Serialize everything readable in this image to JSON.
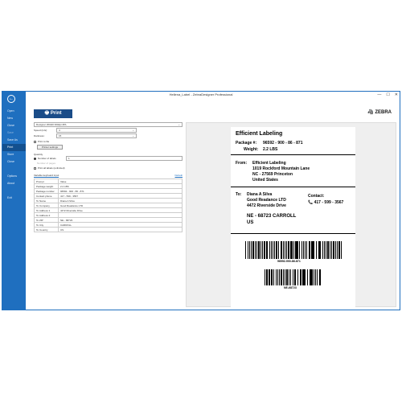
{
  "window": {
    "title": "Hellena_Label - ZebraDesigner Professional",
    "controls": [
      "—",
      "☐",
      "✕"
    ]
  },
  "sidebar": {
    "back_icon": "←",
    "items": [
      {
        "label": "Open"
      },
      {
        "label": "New"
      },
      {
        "label": "Close"
      },
      {
        "label": "Save"
      },
      {
        "label": "Save As"
      },
      {
        "label": "Print"
      },
      {
        "label": "Store"
      },
      {
        "label": "Close"
      },
      {
        "label": "Options"
      },
      {
        "label": "About"
      },
      {
        "label": "Exit"
      }
    ],
    "active_index": 5,
    "disabled_index": 3
  },
  "print_button": {
    "label": "Print",
    "icon": "printer-icon"
  },
  "brand": {
    "label": "ZEBRA"
  },
  "printer": {
    "selected": "Designer ZD420 300dpi ZPL"
  },
  "speed": {
    "label": "Speed (in/s):",
    "value": "4"
  },
  "darkness": {
    "label": "Darkness:",
    "value": "15"
  },
  "print_to_file": {
    "label": "Print to file"
  },
  "printer_settings": {
    "label": "Printer settings"
  },
  "quantity": {
    "heading": "Quantity",
    "number_of_labels": {
      "label": "Number of labels",
      "value": "1"
    },
    "number_of_pages": {
      "label": "Number of pages"
    },
    "print_all": {
      "label": "Print all labels (unlimited)"
    }
  },
  "variables": {
    "tab": "Variable keyboard input",
    "reset_link": "Default",
    "rows": [
      {
        "name": "Prompt",
        "value": "Value"
      },
      {
        "name": "Package weight",
        "value": "2.2 LBS"
      },
      {
        "name": "Package number",
        "value": "96592 - 900 - 86 - 871"
      },
      {
        "name": "Contact phone",
        "value": "417 - 599 - 3567"
      },
      {
        "name": "To Name",
        "value": "Diana A Silva"
      },
      {
        "name": "To Company",
        "value": "Good Readance LTD"
      },
      {
        "name": "To Address 1",
        "value": "4472 Riverside Drive"
      },
      {
        "name": "To Address 2",
        "value": ""
      },
      {
        "name": "To ZIP",
        "value": "NE - 68723"
      },
      {
        "name": "To City",
        "value": "CARROLL"
      },
      {
        "name": "To Country",
        "value": "US"
      }
    ]
  },
  "label": {
    "logo": "Efficient Labeling",
    "package_label": "Package #:",
    "package_value": "96592 - 900 - 86 - 871",
    "weight_label": "Weight:",
    "weight_value": "2.2 LBS",
    "from_label": "From:",
    "from_lines": [
      "Efficient Labeling",
      "1019  Rockford Mountain Lane",
      "NC - 27569  Princeton",
      "United States"
    ],
    "to_label": "To:",
    "to_lines": [
      "Diana A Silva",
      "Good Readance LTD",
      "4472  Riverside Drive"
    ],
    "to_city_line": "NE - 68723   CARROLL",
    "to_country": "US",
    "contact_label": "Contact:",
    "contact_value": "417 - 599 - 3567",
    "barcode1_text": "96592-900-86-871",
    "barcode2_text": "NE-68723"
  }
}
